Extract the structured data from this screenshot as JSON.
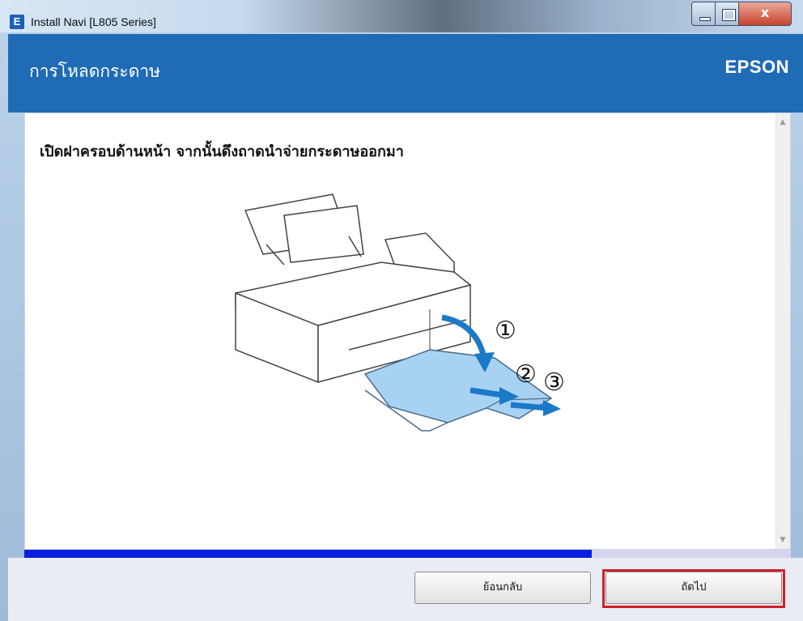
{
  "window": {
    "title": "Install Navi [L805 Series]",
    "app_icon_letter": "E",
    "close_glyph": "x"
  },
  "header": {
    "title": "การโหลดกระดาษ",
    "brand": "EPSON"
  },
  "content": {
    "instruction": "เปิดฝาครอบด้านหน้า จากนั้นดึงถาดนำจ่ายกระดาษออกมา",
    "steps": [
      "①",
      "②",
      "③"
    ]
  },
  "progress": {
    "fraction": 0.74
  },
  "footer": {
    "back_label": "ย้อนกลับ",
    "next_label": "ถัดไป"
  },
  "colors": {
    "header_bg": "#1f6bb6",
    "progress_fill": "#0b1ee0",
    "highlight": "#d0202a",
    "tray_blue": "#a8d2f2"
  }
}
